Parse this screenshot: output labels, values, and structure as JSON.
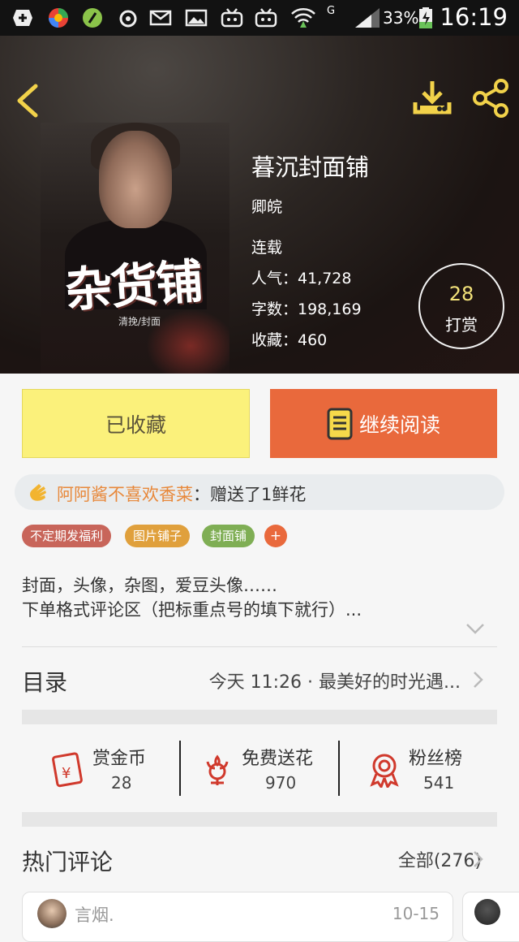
{
  "status_bar": {
    "battery": "33%",
    "time": "16:19",
    "network": "G"
  },
  "book": {
    "cover_title": "杂货铺",
    "cover_subtitle": "清挽/封面",
    "title": "暮沉封面铺",
    "author": "卿皖",
    "status": "连载",
    "popularity": "人气：41,728",
    "word_count": "字数：198,169",
    "favorites": "收藏：460"
  },
  "tip": {
    "count": "28",
    "label": "打赏"
  },
  "actions": {
    "favorite_label": "已收藏",
    "read_label": "继续阅读"
  },
  "gift": {
    "user": "阿阿酱不喜欢香菜",
    "message": "：赠送了1鲜花"
  },
  "tags": [
    {
      "label": "不定期发福利",
      "color": "#c8655a"
    },
    {
      "label": "图片铺子",
      "color": "#e0a03c"
    },
    {
      "label": "封面铺",
      "color": "#7fae54"
    }
  ],
  "tag_add": "+",
  "description": {
    "line1": "封面，头像，杂图，爱豆头像……",
    "line2": "下单格式评论区（把标重点号的填下就行）..."
  },
  "toc": {
    "label": "目录",
    "latest": "今天 11:26 · 最美好的时光遇..."
  },
  "stats": [
    {
      "label": "赏金币",
      "value": "28"
    },
    {
      "label": "免费送花",
      "value": "970"
    },
    {
      "label": "粉丝榜",
      "value": "541"
    }
  ],
  "comments": {
    "title": "热门评论",
    "all_label": "全部(276)",
    "items": [
      {
        "name": "言烟.",
        "date": "10-15"
      }
    ]
  },
  "colors": {
    "accent_orange": "#e9693c",
    "fav_yellow": "#fbf17b",
    "icon_gold": "#f2d24a",
    "stat_red": "#d0392c"
  }
}
